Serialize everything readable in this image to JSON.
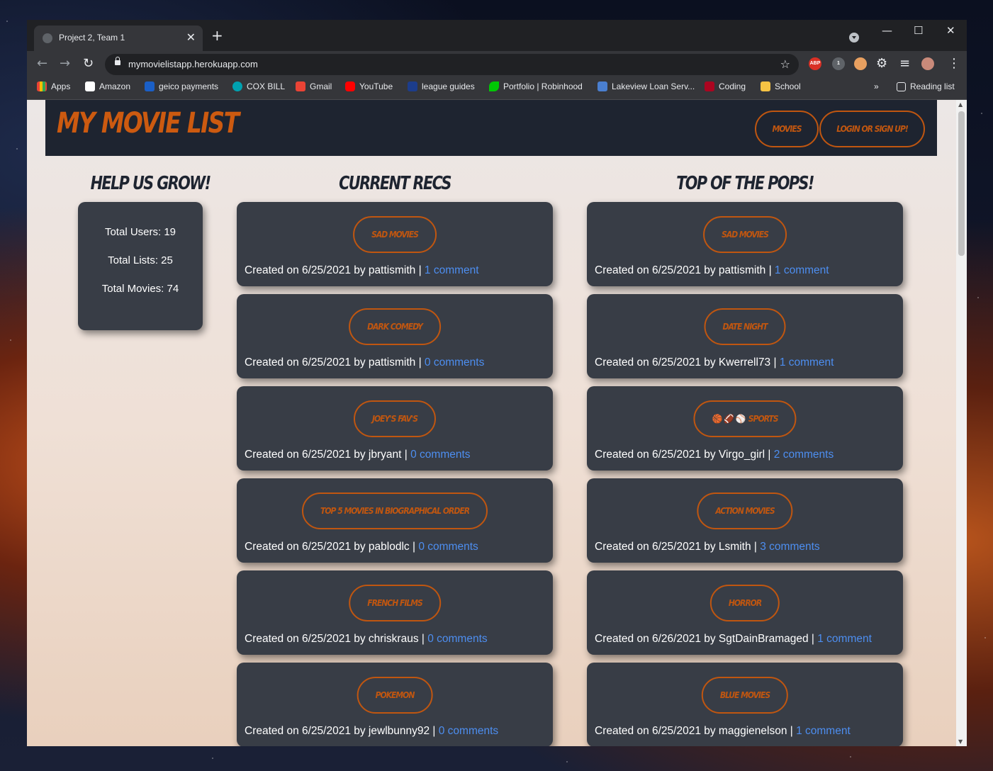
{
  "browser": {
    "tab_title": "Project 2, Team 1",
    "url": "mymovielistapp.herokuapp.com",
    "bookmarks": [
      "Apps",
      "Amazon",
      "geico payments",
      "COX BILL",
      "Gmail",
      "YouTube",
      "league guides",
      "Portfolio | Robinhood",
      "Lakeview Loan Serv...",
      "Coding",
      "School"
    ],
    "more_bookmarks": "»",
    "reading_list": "Reading list",
    "extensions": [
      "ABP",
      "1"
    ]
  },
  "site": {
    "logo": "MY MOVIE LIST",
    "nav": {
      "movies": "Movies",
      "login": "Login or Sign Up!"
    }
  },
  "stats": {
    "heading": "Help Us Grow!",
    "total_users": "Total Users: 19",
    "total_lists": "Total Lists: 25",
    "total_movies": "Total Movies: 74"
  },
  "current_recs": {
    "heading": "Current Recs",
    "items": [
      {
        "title": "Sad Movies",
        "meta": "Created on 6/25/2021 by pattismith | ",
        "comments": "1 comment"
      },
      {
        "title": "Dark Comedy",
        "meta": "Created on 6/25/2021 by pattismith | ",
        "comments": "0 comments"
      },
      {
        "title": "Joey's Fav's",
        "meta": "Created on 6/25/2021 by jbryant | ",
        "comments": "0 comments"
      },
      {
        "title": "Top 5 Movies in Biographical Order",
        "meta": "Created on 6/25/2021 by pablodlc | ",
        "comments": "0 comments"
      },
      {
        "title": "French Films",
        "meta": "Created on 6/25/2021 by chriskraus | ",
        "comments": "0 comments"
      },
      {
        "title": "Pokemon",
        "meta": "Created on 6/25/2021 by jewlbunny92 | ",
        "comments": "0 comments"
      }
    ]
  },
  "top_pops": {
    "heading": "Top of the Pops!",
    "items": [
      {
        "title": "Sad Movies",
        "meta": "Created on 6/25/2021 by pattismith | ",
        "comments": "1 comment"
      },
      {
        "title": "Date Night",
        "meta": "Created on 6/25/2021 by Kwerrell73 | ",
        "comments": "1 comment"
      },
      {
        "title": "Sports",
        "emoji": "🏀 🏈 ⚾",
        "meta": "Created on 6/25/2021 by Virgo_girl | ",
        "comments": "2 comments"
      },
      {
        "title": "Action Movies",
        "meta": "Created on 6/25/2021 by Lsmith | ",
        "comments": "3 comments"
      },
      {
        "title": "Horror",
        "meta": "Created on 6/26/2021 by SgtDainBramaged | ",
        "comments": "1 comment"
      },
      {
        "title": "Blue Movies",
        "meta": "Created on 6/25/2021 by maggienelson | ",
        "comments": "1 comment"
      }
    ]
  },
  "colors": {
    "accent": "#c05610",
    "card": "#383d46",
    "nav": "#1e2430",
    "link": "#4d8ef0"
  }
}
